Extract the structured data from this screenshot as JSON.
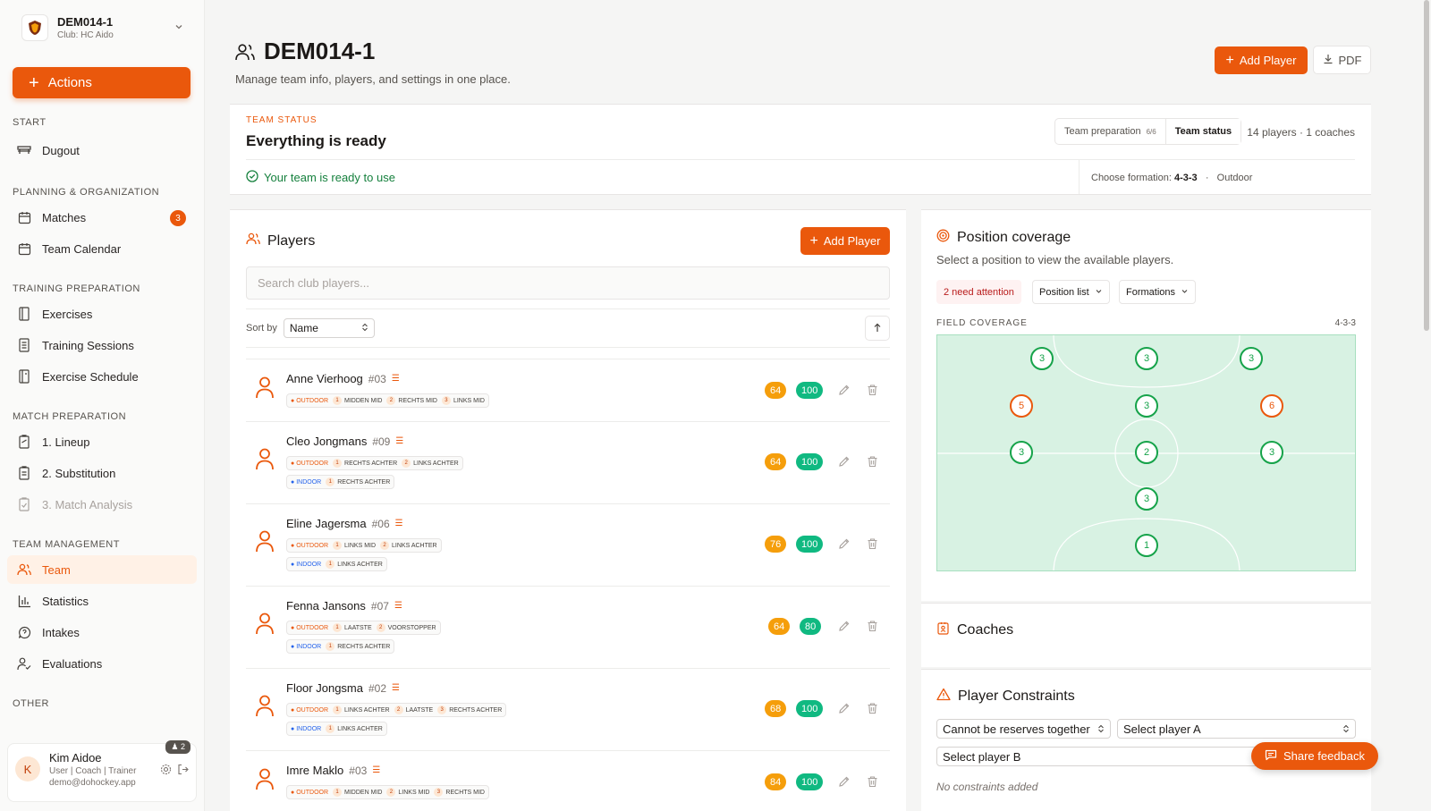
{
  "team_switcher": {
    "name": "DEM014-1",
    "club": "Club: HC Aido"
  },
  "sidebar": {
    "actions_label": "Actions",
    "sections": {
      "start": "START",
      "planning": "PLANNING & ORGANIZATION",
      "training": "TRAINING PREPARATION",
      "match": "MATCH PREPARATION",
      "team": "TEAM MANAGEMENT",
      "other": "OTHER"
    },
    "items": {
      "dugout": "Dugout",
      "matches": "Matches",
      "matches_badge": "3",
      "team_calendar": "Team Calendar",
      "exercises": "Exercises",
      "training_sessions": "Training Sessions",
      "exercise_schedule": "Exercise Schedule",
      "lineup": "1. Lineup",
      "substitution": "2. Substitution",
      "match_analysis": "3. Match Analysis",
      "team": "Team",
      "statistics": "Statistics",
      "intakes": "Intakes",
      "evaluations": "Evaluations"
    }
  },
  "user": {
    "initial": "K",
    "name": "Kim Aidoe",
    "roles": "User | Coach | Trainer",
    "email": "demo@dohockey.app",
    "count": "2"
  },
  "header": {
    "title": "DEM014-1",
    "subtitle": "Manage team info, players, and settings in one place.",
    "add_player": "Add Player",
    "pdf": "PDF"
  },
  "status": {
    "kicker": "TEAM STATUS",
    "title": "Everything is ready",
    "tab_prep": "Team preparation",
    "tab_prep_frac": "6/6",
    "tab_status": "Team status",
    "counts": "14 players · 1 coaches",
    "ready": "Your team is ready to use",
    "formation_label": "Choose formation:",
    "formation_value": "4-3-3",
    "formation_sep": "·",
    "formation_context": "Outdoor"
  },
  "players": {
    "title": "Players",
    "add_player": "Add Player",
    "search_placeholder": "Search club players...",
    "sort_label": "Sort by",
    "sort_value": "Name",
    "outdoor": "OUTDOOR",
    "indoor": "INDOOR",
    "list": [
      {
        "name": "Anne Vierhoog",
        "number": "#03",
        "outdoor": [
          [
            "1",
            "MIDDEN MID"
          ],
          [
            "2",
            "RECHTS MID"
          ],
          [
            "3",
            "LINKS MID"
          ]
        ],
        "indoor": [],
        "score_a": "64",
        "score_b": "100"
      },
      {
        "name": "Cleo Jongmans",
        "number": "#09",
        "outdoor": [
          [
            "1",
            "RECHTS ACHTER"
          ],
          [
            "2",
            "LINKS ACHTER"
          ]
        ],
        "indoor": [
          [
            "1",
            "RECHTS ACHTER"
          ]
        ],
        "score_a": "64",
        "score_b": "100"
      },
      {
        "name": "Eline Jagersma",
        "number": "#06",
        "outdoor": [
          [
            "1",
            "LINKS MID"
          ],
          [
            "2",
            "LINKS ACHTER"
          ]
        ],
        "indoor": [
          [
            "1",
            "LINKS ACHTER"
          ]
        ],
        "score_a": "76",
        "score_b": "100"
      },
      {
        "name": "Fenna Jansons",
        "number": "#07",
        "outdoor": [
          [
            "1",
            "LAATSTE"
          ],
          [
            "2",
            "VOORSTOPPER"
          ]
        ],
        "indoor": [
          [
            "1",
            "RECHTS ACHTER"
          ]
        ],
        "score_a": "64",
        "score_b": "80"
      },
      {
        "name": "Floor Jongsma",
        "number": "#02",
        "outdoor": [
          [
            "1",
            "LINKS ACHTER"
          ],
          [
            "2",
            "LAATSTE"
          ],
          [
            "3",
            "RECHTS ACHTER"
          ]
        ],
        "indoor": [
          [
            "1",
            "LINKS ACHTER"
          ]
        ],
        "score_a": "68",
        "score_b": "100"
      },
      {
        "name": "Imre Maklo",
        "number": "#03",
        "outdoor": [
          [
            "1",
            "MIDDEN MID"
          ],
          [
            "2",
            "LINKS MID"
          ],
          [
            "3",
            "RECHTS MID"
          ]
        ],
        "indoor": [],
        "score_a": "84",
        "score_b": "100"
      }
    ]
  },
  "coverage": {
    "title": "Position coverage",
    "subtitle": "Select a position to view the available players.",
    "attention": "2 need attention",
    "position_list": "Position list",
    "formations": "Formations",
    "field_label": "FIELD COVERAGE",
    "formation": "4-3-3",
    "positions": [
      {
        "value": "3",
        "warn": false
      },
      {
        "value": "3",
        "warn": false
      },
      {
        "value": "3",
        "warn": false
      },
      {
        "value": "5",
        "warn": true
      },
      {
        "value": "3",
        "warn": false
      },
      {
        "value": "6",
        "warn": true
      },
      {
        "value": "3",
        "warn": false
      },
      {
        "value": "2",
        "warn": false
      },
      {
        "value": "3",
        "warn": false
      },
      {
        "value": "3",
        "warn": false
      },
      {
        "value": "1",
        "warn": false
      }
    ],
    "colors": {
      "ok": "#16a34a",
      "warn": "#ea580c",
      "field": "#d8f2e3"
    }
  },
  "coaches": {
    "title": "Coaches"
  },
  "constraints": {
    "title": "Player Constraints",
    "type_value": "Cannot be reserves together",
    "player_a": "Select player A",
    "player_b": "Select player B",
    "empty": "No constraints added"
  },
  "feedback": {
    "label": "Share feedback"
  },
  "colors": {
    "accent": "#ea580c",
    "success": "#10b981",
    "warning": "#f59e0b"
  }
}
